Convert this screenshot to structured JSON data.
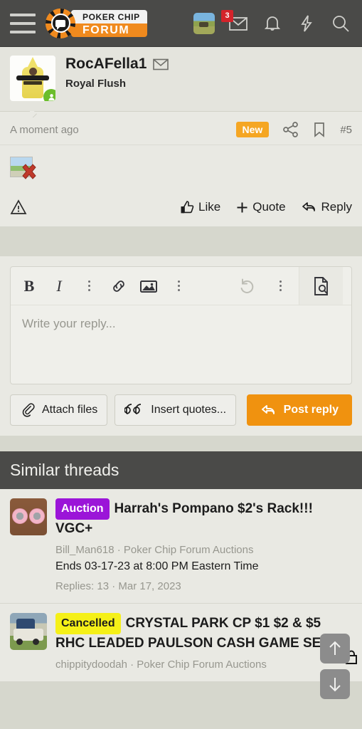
{
  "header": {
    "menu_icon": "hamburger-menu-icon",
    "logo_top": "POKER CHIP",
    "logo_bottom": "FORUM",
    "avatar_icon": "user-avatar-thumbnail",
    "inbox_icon": "envelope-icon",
    "inbox_count": "3",
    "alerts_icon": "bell-icon",
    "whats_new_icon": "lightning-bolt-icon",
    "search_icon": "search-icon"
  },
  "post": {
    "username": "RocAFella1",
    "message_icon": "envelope-icon",
    "user_title": "Royal Flush",
    "online_indicator": "online-status-icon",
    "timestamp": "A moment ago",
    "new_badge": "New",
    "share_icon": "share-icon",
    "bookmark_icon": "bookmark-icon",
    "post_number": "#5",
    "content_image": "broken-image-placeholder",
    "report_icon": "warning-triangle-icon",
    "like_label": "Like",
    "like_icon": "thumbs-up-icon",
    "quote_label": "Quote",
    "quote_icon": "plus-icon",
    "reply_label": "Reply",
    "reply_icon": "reply-arrow-icon"
  },
  "editor": {
    "bold_label": "B",
    "italic_label": "I",
    "more_icon": "vertical-dots-icon",
    "link_icon": "link-icon",
    "image_icon": "image-icon",
    "more2_icon": "vertical-dots-icon",
    "undo_icon": "undo-icon",
    "more3_icon": "vertical-dots-icon",
    "preview_icon": "document-preview-icon",
    "placeholder": "Write your reply...",
    "attach_label": "Attach files",
    "attach_icon": "paperclip-icon",
    "insert_quotes_label": "Insert quotes...",
    "insert_quotes_icon": "quote-marks-icon",
    "post_reply_label": "Post reply",
    "post_reply_icon": "reply-arrow-icon",
    "primary_color": "#f0920f"
  },
  "similar_threads": {
    "title": "Similar threads",
    "items": [
      {
        "thumbnail": "poker-chips-photo",
        "tag": "Auction",
        "tag_color": "#9b15d8",
        "title": "Harrah's Pompano $2's Rack!!! VGC+",
        "author_forum": "Bill_Man618 · Poker Chip Forum Auctions",
        "subtitle": "Ends 03-17-23 at 8:00 PM Eastern Time",
        "stats": "Replies: 13 · Mar 17, 2023"
      },
      {
        "thumbnail": "white-truck-photo",
        "tag": "Cancelled",
        "tag_color": "#f5f018",
        "title": "CRYSTAL PARK CP $1 $2 & $5 RHC LEADED PAULSON CASH GAME SET",
        "author_forum": "chippitydoodah · Poker Chip Forum Auctions",
        "subtitle": "",
        "stats": ""
      }
    ]
  },
  "floating": {
    "scroll_up_icon": "arrow-up-icon",
    "scroll_down_icon": "arrow-down-icon",
    "lock_icon": "lock-icon"
  }
}
